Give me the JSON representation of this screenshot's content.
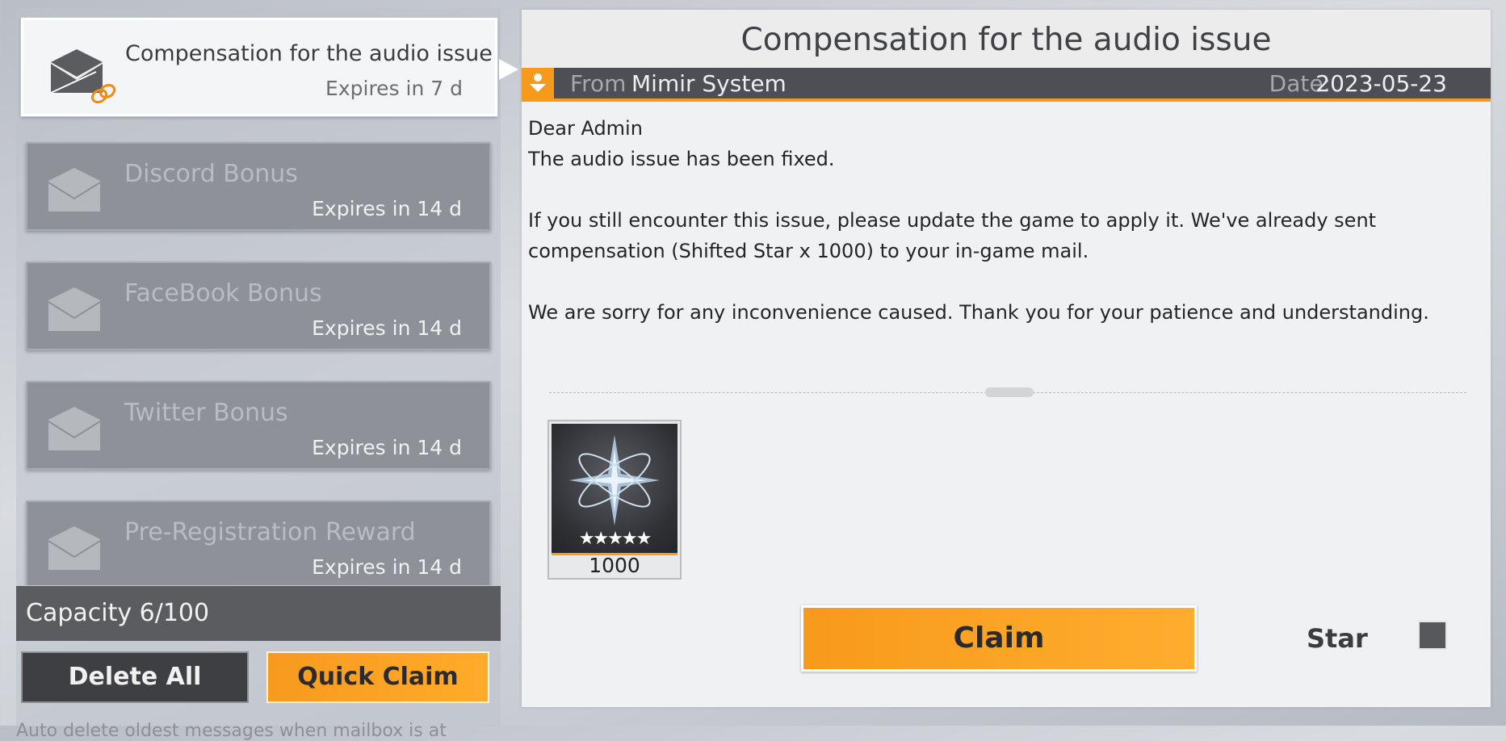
{
  "mail_list": {
    "items": [
      {
        "title": "Compensation for the audio issue",
        "expires": "Expires in 7 d",
        "selected": true,
        "has_attachment": true
      },
      {
        "title": "Discord Bonus",
        "expires": "Expires in 14 d",
        "selected": false
      },
      {
        "title": "FaceBook Bonus",
        "expires": "Expires in 14 d",
        "selected": false
      },
      {
        "title": "Twitter Bonus",
        "expires": "Expires in 14 d",
        "selected": false
      },
      {
        "title": "Pre-Registration Reward",
        "expires": "Expires in 14 d",
        "selected": false
      }
    ],
    "envelope_icon": "envelope-icon",
    "attachment_icon": "paperclip-icon"
  },
  "capacity": "Capacity 6/100",
  "buttons": {
    "delete_all": "Delete All",
    "quick_claim": "Quick Claim",
    "claim": "Claim"
  },
  "auto_note": "Auto delete oldest messages when mailbox is at",
  "detail": {
    "title": "Compensation for the audio issue",
    "from_label": "From",
    "from_name": "Mimir System",
    "sender_icon": "person-icon",
    "date_label": "Date:",
    "date_value": "2023-05-23",
    "body": [
      "Dear Admin",
      "The audio issue has been fixed.",
      "If you still encounter this issue, please update the game to apply it. We've already sent",
      "compensation (Shifted Star x 1000) to your in-game mail.",
      "We are sorry for any inconvenience caused. Thank you for your patience and understanding."
    ],
    "reward": {
      "icon": "shifted-star-icon",
      "stars": "★★★★★",
      "count": "1000"
    },
    "star_label": "Star"
  },
  "colors": {
    "accent": "#f59a1c",
    "dark_bar": "#4d4f54",
    "panel": "#f0f1f2"
  }
}
